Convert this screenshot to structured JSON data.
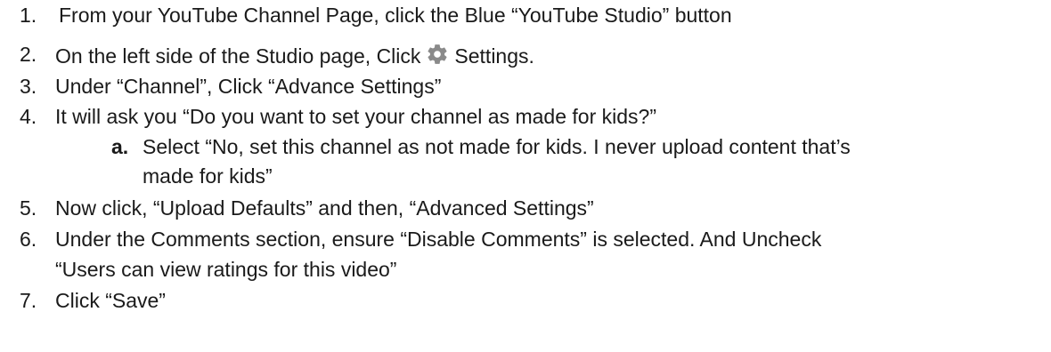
{
  "steps": [
    {
      "number": "1.",
      "text": "From your YouTube Channel Page, click the Blue “YouTube Studio” button"
    },
    {
      "number": "2.",
      "text_before": "On the left side of the Studio page, Click",
      "icon": "gear-icon",
      "text_after": "Settings."
    },
    {
      "number": "3.",
      "text": "Under “Channel”, Click “Advance Settings”"
    },
    {
      "number": "4.",
      "text": "It will ask you “Do you want to set your channel as made for kids?”"
    },
    {
      "number": "5.",
      "text": "Now click, “Upload Defaults” and then, “Advanced Settings”"
    },
    {
      "number": "6.",
      "text_line1": "Under the Comments section, ensure “Disable Comments” is selected. And Uncheck",
      "text_line2": "“Users can view ratings for this video”"
    },
    {
      "number": "7.",
      "text": "Click “Save”"
    }
  ],
  "substep": {
    "letter": "a.",
    "text_line1": "Select “No, set this channel as not made for kids. I never upload content that’s",
    "text_line2": "made for kids”"
  },
  "colors": {
    "text": "#1a1a1a",
    "icon": "#8a8a8a"
  }
}
